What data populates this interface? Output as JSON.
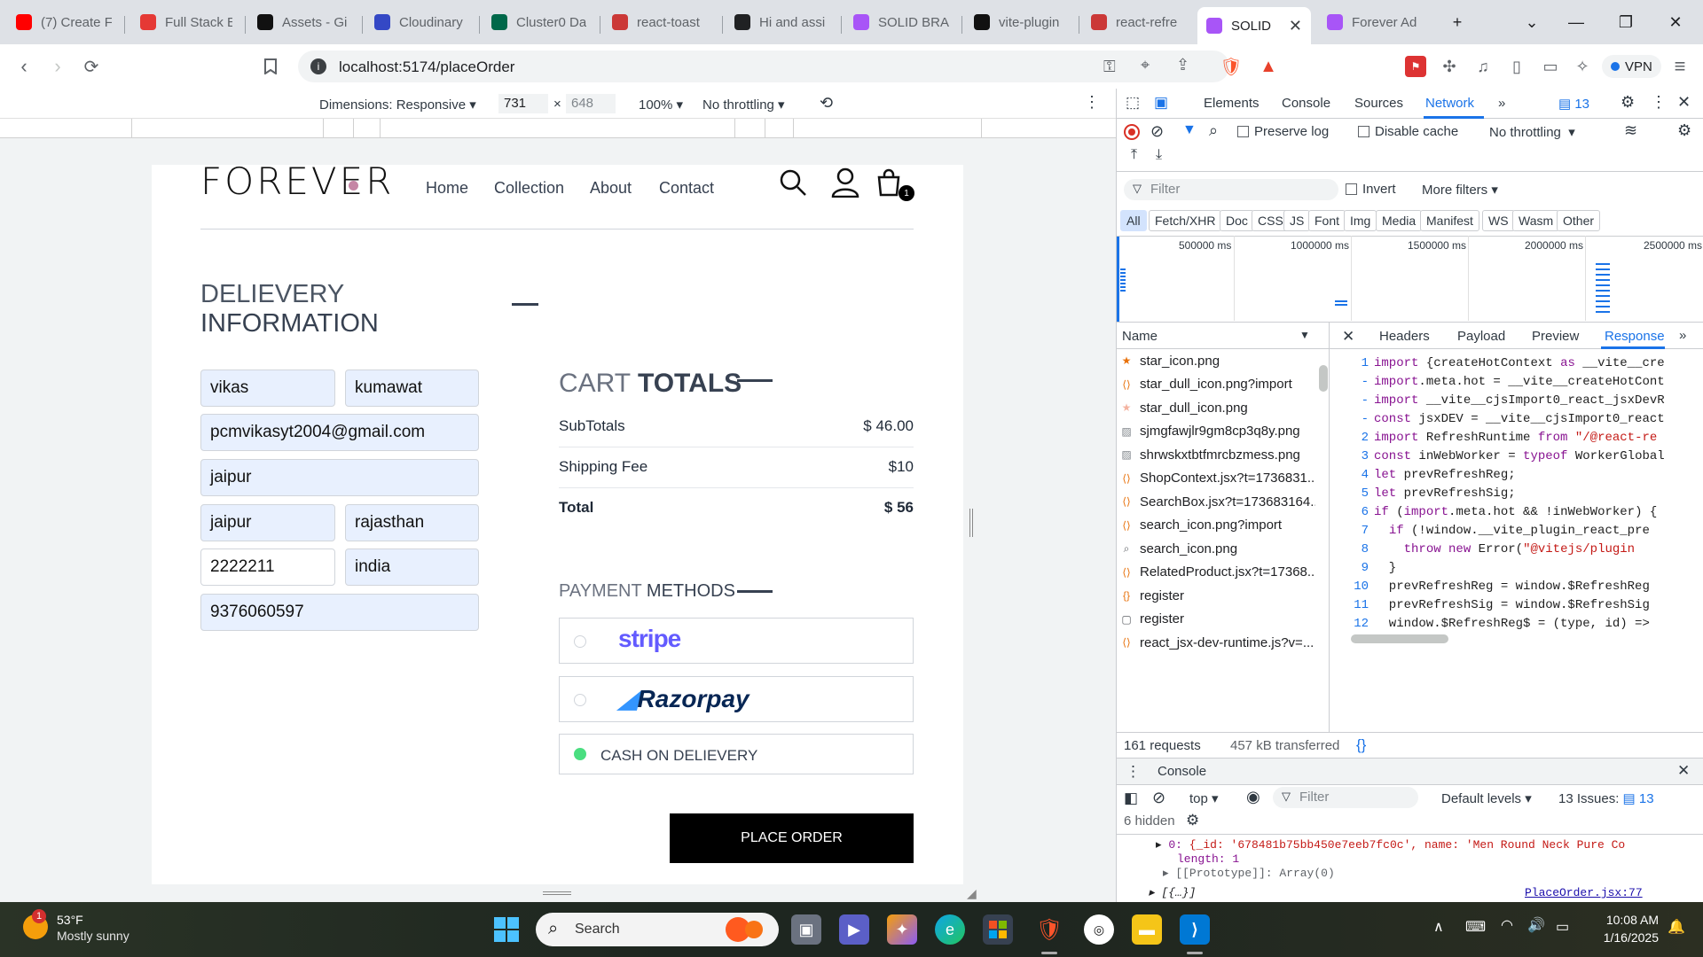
{
  "tabs": [
    {
      "title": "(7) Create F",
      "icon": "youtube-icon",
      "color": "#ff0000"
    },
    {
      "title": "Full Stack E",
      "icon": "react-icon",
      "color": "#e53935"
    },
    {
      "title": "Assets - Gi",
      "icon": "github-icon",
      "color": "#111111"
    },
    {
      "title": "Cloudinary",
      "icon": "cloudinary-icon",
      "color": "#3448c5"
    },
    {
      "title": "Cluster0 Da",
      "icon": "mongodb-icon",
      "color": "#00684a"
    },
    {
      "title": "react-toast",
      "icon": "npm-icon",
      "color": "#cb3837"
    },
    {
      "title": "Hi and assi",
      "icon": "chatgpt-icon",
      "color": "#202123"
    },
    {
      "title": "SOLID BRA",
      "icon": "vite-icon",
      "color": "#a855f7"
    },
    {
      "title": "vite-plugin",
      "icon": "github-icon",
      "color": "#111111"
    },
    {
      "title": "react-refre",
      "icon": "npm-icon",
      "color": "#cb3837"
    },
    {
      "title": "SOLID",
      "icon": "vite-icon",
      "color": "#a855f7",
      "active": true
    },
    {
      "title": "Forever Ad",
      "icon": "vite-icon",
      "color": "#a855f7"
    }
  ],
  "toolbar": {
    "url": "localhost:5174/placeOrder",
    "vpn_label": "VPN"
  },
  "device_toolbar": {
    "dimensions_label": "Dimensions: Responsive",
    "width": "731",
    "height": "648",
    "times": "×",
    "zoom": "100%",
    "throttling": "No throttling"
  },
  "site": {
    "logo": "FOREVER",
    "nav": [
      "Home",
      "Collection",
      "About",
      "Contact"
    ],
    "cart_count": "1",
    "delivery_title_1": "DELIEVERY",
    "delivery_title_2": "INFORMATION",
    "fields": {
      "first_name": "vikas",
      "last_name": "kumawat",
      "email": "pcmvikasyt2004@gmail.com",
      "street": "jaipur",
      "city": "jaipur",
      "state": "rajasthan",
      "zipcode": "2222211",
      "country": "india",
      "phone": "9376060597"
    },
    "cart_totals_1": "CART",
    "cart_totals_2": "TOTALS",
    "subtotal_label": "SubTotals",
    "subtotal_value": "$ 46.00",
    "shipping_label": "Shipping Fee",
    "shipping_value": "$10",
    "total_label": "Total",
    "total_value": "$ 56",
    "payment_1": "PAYMENT",
    "payment_2": "METHODS",
    "stripe": "stripe",
    "razorpay": "Razorpay",
    "cod": "CASH ON DELIEVERY",
    "place_order": "PLACE ORDER"
  },
  "devtools": {
    "tabs": [
      "Elements",
      "Console",
      "Sources",
      "Network"
    ],
    "active_tab": "Network",
    "issues_count": "13",
    "preserve_log": "Preserve log",
    "disable_cache": "Disable cache",
    "throttling": "No throttling",
    "filter_placeholder": "Filter",
    "invert": "Invert",
    "more_filters": "More filters",
    "chips": [
      "All",
      "Fetch/XHR",
      "Doc",
      "CSS",
      "JS",
      "Font",
      "Img",
      "Media",
      "Manifest",
      "WS",
      "Wasm",
      "Other"
    ],
    "timeline": [
      "500000 ms",
      "1000000 ms",
      "1500000 ms",
      "2000000 ms",
      "2500000 ms"
    ],
    "name_header": "Name",
    "detail_tabs": [
      "Headers",
      "Payload",
      "Preview",
      "Response"
    ],
    "files": [
      {
        "name": "star_icon.png",
        "icon": "star-icon"
      },
      {
        "name": "star_dull_icon.png?import",
        "icon": "script-icon"
      },
      {
        "name": "star_dull_icon.png",
        "icon": "star-icon"
      },
      {
        "name": "sjmgfawjlr9gm8cp3q8y.png",
        "icon": "image-icon"
      },
      {
        "name": "shrwskxtbtfmrcbzmess.png",
        "icon": "image-icon"
      },
      {
        "name": "ShopContext.jsx?t=1736831...",
        "icon": "script-icon"
      },
      {
        "name": "SearchBox.jsx?t=173683164...",
        "icon": "script-icon"
      },
      {
        "name": "search_icon.png?import",
        "icon": "script-icon"
      },
      {
        "name": "search_icon.png",
        "icon": "search-icon"
      },
      {
        "name": "RelatedProduct.jsx?t=17368...",
        "icon": "script-icon"
      },
      {
        "name": "register",
        "icon": "fetch-icon"
      },
      {
        "name": "register",
        "icon": "doc-icon"
      },
      {
        "name": "react_jsx-dev-runtime.js?v=...",
        "icon": "script-icon"
      }
    ],
    "code_lines": [
      {
        "n": "1",
        "t": "import {createHotContext as __vite__cre"
      },
      {
        "n": "-",
        "t": "import.meta.hot = __vite__createHotCont"
      },
      {
        "n": "-",
        "t": "import __vite__cjsImport0_react_jsxDevR"
      },
      {
        "n": "-",
        "t": "const jsxDEV = __vite__cjsImport0_react"
      },
      {
        "n": "2",
        "t": "import RefreshRuntime from \"/@react-re"
      },
      {
        "n": "3",
        "t": "const inWebWorker = typeof WorkerGlobal"
      },
      {
        "n": "4",
        "t": "let prevRefreshReg;"
      },
      {
        "n": "5",
        "t": "let prevRefreshSig;"
      },
      {
        "n": "6",
        "t": "if (import.meta.hot && !inWebWorker) {"
      },
      {
        "n": "7",
        "t": "  if (!window.__vite_plugin_react_pre"
      },
      {
        "n": "8",
        "t": "    throw new Error(\"@vitejs/plugin"
      },
      {
        "n": "9",
        "t": "  }"
      },
      {
        "n": "10",
        "t": "  prevRefreshReg = window.$RefreshReg"
      },
      {
        "n": "11",
        "t": "  prevRefreshSig = window.$RefreshSig"
      },
      {
        "n": "12",
        "t": "  window.$RefreshReg$ = (type, id) =>"
      }
    ],
    "requests": "161 requests",
    "transferred": "457 kB transferred",
    "console_title": "Console",
    "context": "top",
    "console_filter": "Filter",
    "levels": "Default levels",
    "issues_label": "13 Issues:",
    "issues_num": "13",
    "hidden": "6 hidden",
    "log_1_key": "0:",
    "log_1_val": "{_id: '678481b75bb450e7eeb7fc0c', name: 'Men Round Neck Pure Co",
    "log_2": "length: 1",
    "log_3": "[[Prototype]]: Array(0)",
    "log_4": "[{…}]",
    "log_source": "PlaceOrder.jsx:77"
  },
  "taskbar": {
    "weather_temp": "53°F",
    "weather_desc": "Mostly sunny",
    "weather_badge": "1",
    "search": "Search",
    "time": "10:08 AM",
    "date": "1/16/2025"
  }
}
